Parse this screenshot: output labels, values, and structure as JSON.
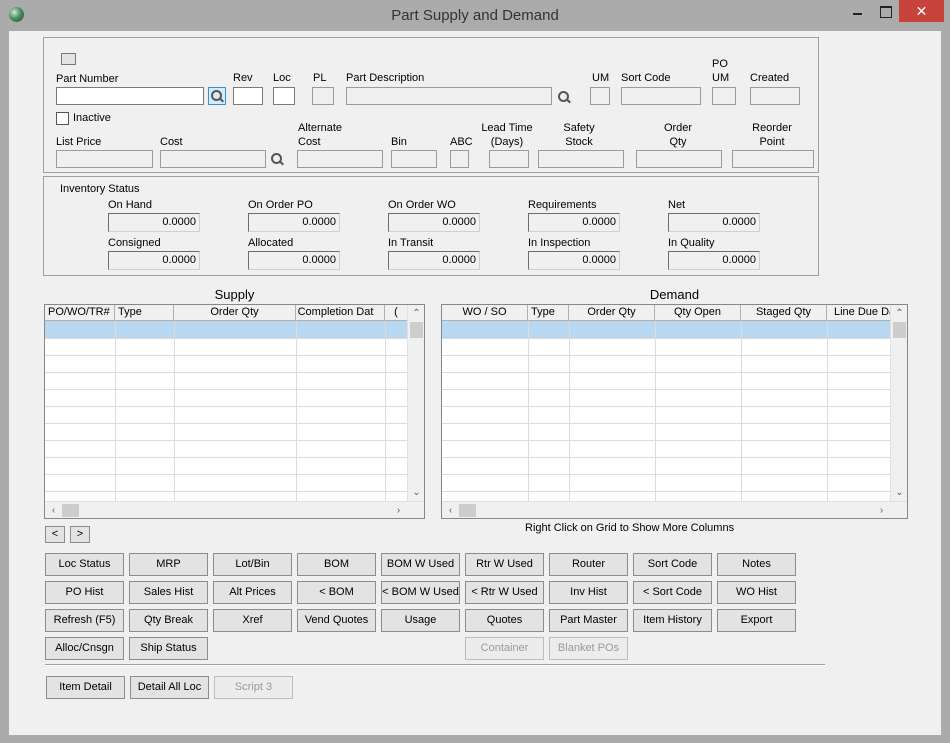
{
  "window": {
    "title": "Part Supply and Demand"
  },
  "part": {
    "part_number_label": "Part Number",
    "rev_label": "Rev",
    "loc_label": "Loc",
    "pl_label": "PL",
    "description_label": "Part Description",
    "um_label": "UM",
    "sort_code_label": "Sort Code",
    "po_um_label_1": "PO",
    "po_um_label_2": "UM",
    "created_label": "Created",
    "inactive_label": "Inactive",
    "list_price_label": "List Price",
    "cost_label": "Cost",
    "alt_cost_label_1": "Alternate",
    "alt_cost_label_2": "Cost",
    "bin_label": "Bin",
    "abc_label": "ABC",
    "lead_time_label_1": "Lead Time",
    "lead_time_label_2": "(Days)",
    "safety_stock_label_1": "Safety",
    "safety_stock_label_2": "Stock",
    "order_qty_label_1": "Order",
    "order_qty_label_2": "Qty",
    "reorder_point_label_1": "Reorder",
    "reorder_point_label_2": "Point"
  },
  "inventory": {
    "title": "Inventory Status",
    "on_hand": {
      "label": "On Hand",
      "value": "0.0000"
    },
    "on_order_po": {
      "label": "On Order PO",
      "value": "0.0000"
    },
    "on_order_wo": {
      "label": "On Order WO",
      "value": "0.0000"
    },
    "requirements": {
      "label": "Requirements",
      "value": "0.0000"
    },
    "net": {
      "label": "Net",
      "value": "0.0000"
    },
    "consigned": {
      "label": "Consigned",
      "value": "0.0000"
    },
    "allocated": {
      "label": "Allocated",
      "value": "0.0000"
    },
    "in_transit": {
      "label": "In Transit",
      "value": "0.0000"
    },
    "in_inspection": {
      "label": "In Inspection",
      "value": "0.0000"
    },
    "in_quality": {
      "label": "In Quality",
      "value": "0.0000"
    }
  },
  "supply": {
    "title": "Supply",
    "columns": [
      "PO/WO/TR#",
      "Type",
      "Order Qty",
      "st Completion Dat",
      "("
    ]
  },
  "demand": {
    "title": "Demand",
    "columns": [
      "WO / SO",
      "Type",
      "Order Qty",
      "Qty Open",
      "Staged Qty",
      "Line Due Da"
    ]
  },
  "nav": {
    "prev": "<",
    "next": ">"
  },
  "hint": "Right Click on Grid to Show More Columns",
  "buttons": {
    "loc_status": "Loc Status",
    "mrp": "MRP",
    "lot_bin": "Lot/Bin",
    "bom": "BOM",
    "bom_w_used": "BOM W Used",
    "rtr_w_used": "Rtr W Used",
    "router": "Router",
    "sort_code": "Sort Code",
    "notes": "Notes",
    "po_hist": "PO Hist",
    "sales_hist": "Sales Hist",
    "alt_prices": "Alt Prices",
    "prev_bom": "< BOM",
    "prev_bom_w_used": "< BOM W Used",
    "prev_rtr_w_used": "< Rtr W Used",
    "inv_hist": "Inv Hist",
    "prev_sort_code": "< Sort Code",
    "wo_hist": "WO Hist",
    "refresh": "Refresh (F5)",
    "qty_break": "Qty Break",
    "xref": "Xref",
    "vend_quotes": "Vend Quotes",
    "usage": "Usage",
    "quotes": "Quotes",
    "part_master": "Part Master",
    "item_history": "Item History",
    "export": "Export",
    "alloc_cnsgn": "Alloc/Cnsgn",
    "ship_status": "Ship Status",
    "container": "Container",
    "blanket_pos": "Blanket POs",
    "item_detail": "Item Detail",
    "detail_all_loc": "Detail All Loc",
    "script3": "Script 3"
  }
}
